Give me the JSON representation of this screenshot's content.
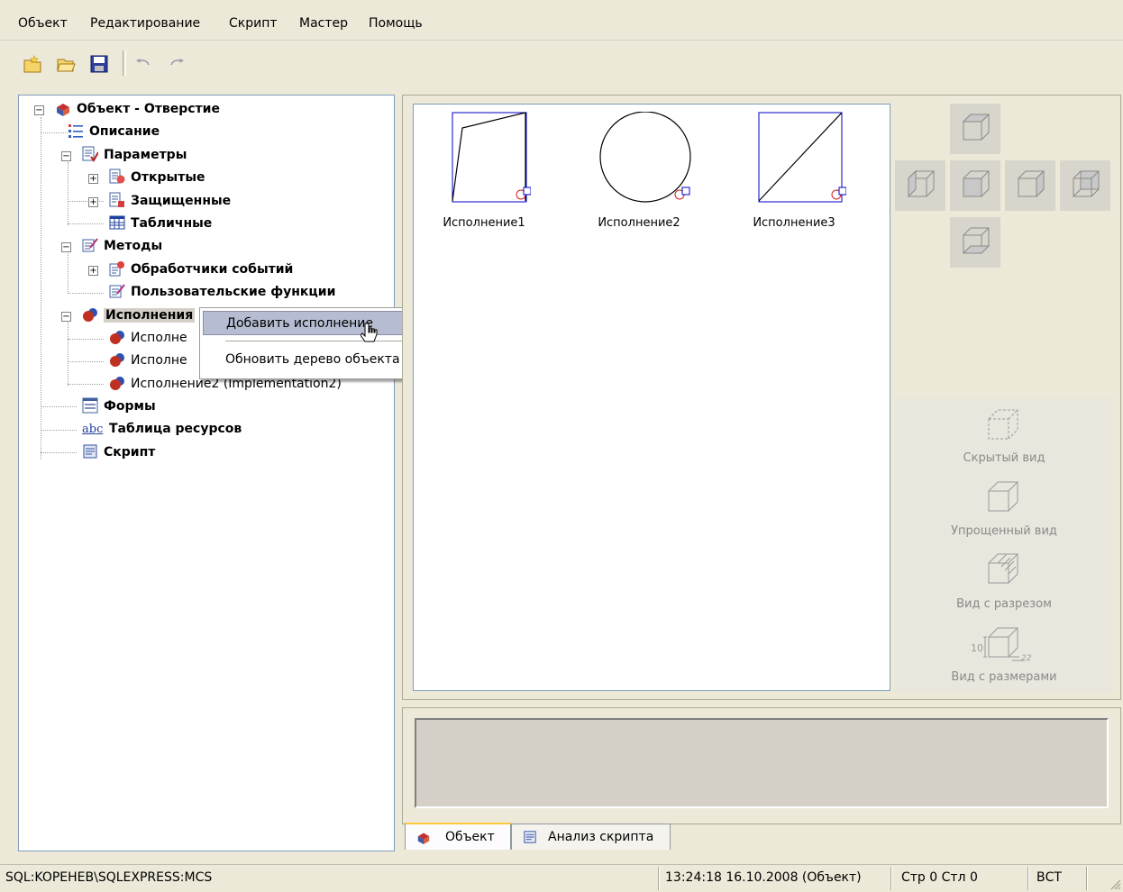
{
  "menu": [
    "Объект",
    "Редактирование",
    "Скрипт",
    "Мастер",
    "Помощь"
  ],
  "toolbar": {
    "buttons": [
      "new-object-icon",
      "open-folder-icon",
      "save-icon",
      "undo-icon",
      "redo-icon"
    ]
  },
  "tree": {
    "root": "Объект - Отверстие",
    "description": "Описание",
    "params": "Параметры",
    "params_open": "Открытые",
    "params_protected": "Защищенные",
    "params_table": "Табличные",
    "methods": "Методы",
    "event_handlers": "Обработчики событий",
    "user_functions": "Пользовательские функции",
    "implementations": "Исполнения",
    "impl_item_1": "Исполне",
    "impl_item_2": "Исполне",
    "impl_item_3": "Исполнение2 (Implementation2)",
    "forms": "Формы",
    "resources": "Таблица ресурсов",
    "script": "Скрипт",
    "resources_icon_text": "abc"
  },
  "context_menu": {
    "add": "Добавить исполнение",
    "refresh": "Обновить дерево объекта"
  },
  "implementations": [
    "Исполнение1",
    "Исполнение2",
    "Исполнение3"
  ],
  "views": {
    "hidden": "Скрытый вид",
    "simplified": "Упрощенный вид",
    "section": "Вид с разрезом",
    "dimensions": "Вид с размерами",
    "dim_label": "10",
    "dim_label_2": "22"
  },
  "tabs": {
    "object": "Объект",
    "script_analysis": "Анализ скрипта"
  },
  "status": {
    "connection": "SQL:KOPEHEB\\SQLEXPRESS:MCS",
    "datetime": "13:24:18  16.10.2008  (Объект)",
    "position": "Стр 0 Стл 0",
    "mode": "ВСТ"
  },
  "colors": {
    "accent_blue": "#0000c8",
    "selection": "#b6bdd2",
    "tab_highlight": "#ffc83c"
  }
}
